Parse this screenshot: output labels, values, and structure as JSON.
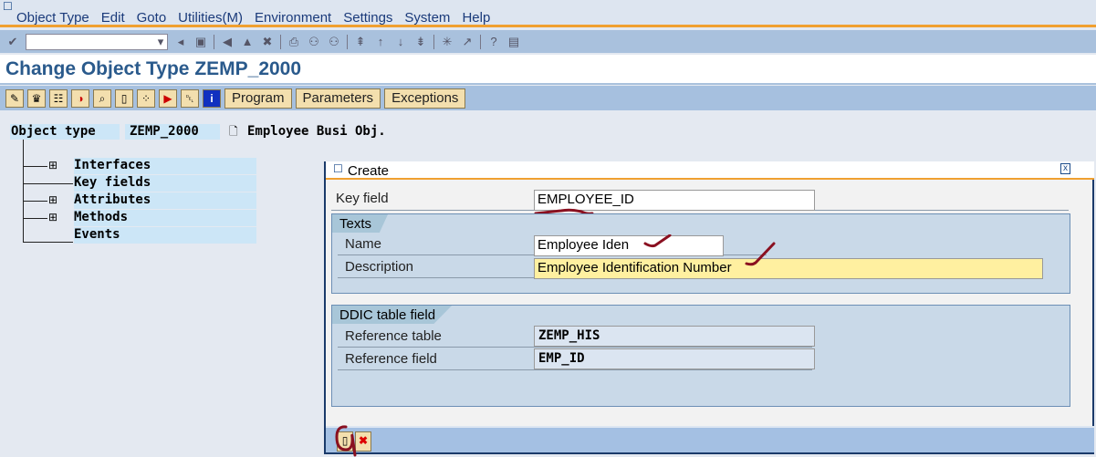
{
  "menu": [
    "Object Type",
    "Edit",
    "Goto",
    "Utilities(M)",
    "Environment",
    "Settings",
    "System",
    "Help"
  ],
  "command_field": "",
  "title": "Change Object Type ZEMP_2000",
  "app_buttons": {
    "program": "Program",
    "parameters": "Parameters",
    "exceptions": "Exceptions"
  },
  "header": {
    "label": "Object type",
    "value": "ZEMP_2000",
    "description": "Employee Busi Obj."
  },
  "tree": [
    "Interfaces",
    "Key fields",
    "Attributes",
    "Methods",
    "Events"
  ],
  "dialog": {
    "title": "Create",
    "key_field_label": "Key field",
    "key_field_value": "EMPLOYEE_ID",
    "texts_tab": "Texts",
    "name_label": "Name",
    "name_value": "Employee Iden",
    "description_label": "Description",
    "description_value": "Employee Identification Number",
    "ddic_tab": "DDIC table field",
    "ref_table_label": "Reference table",
    "ref_table_value": "ZEMP_HIS",
    "ref_field_label": "Reference field",
    "ref_field_value": "EMP_ID"
  }
}
